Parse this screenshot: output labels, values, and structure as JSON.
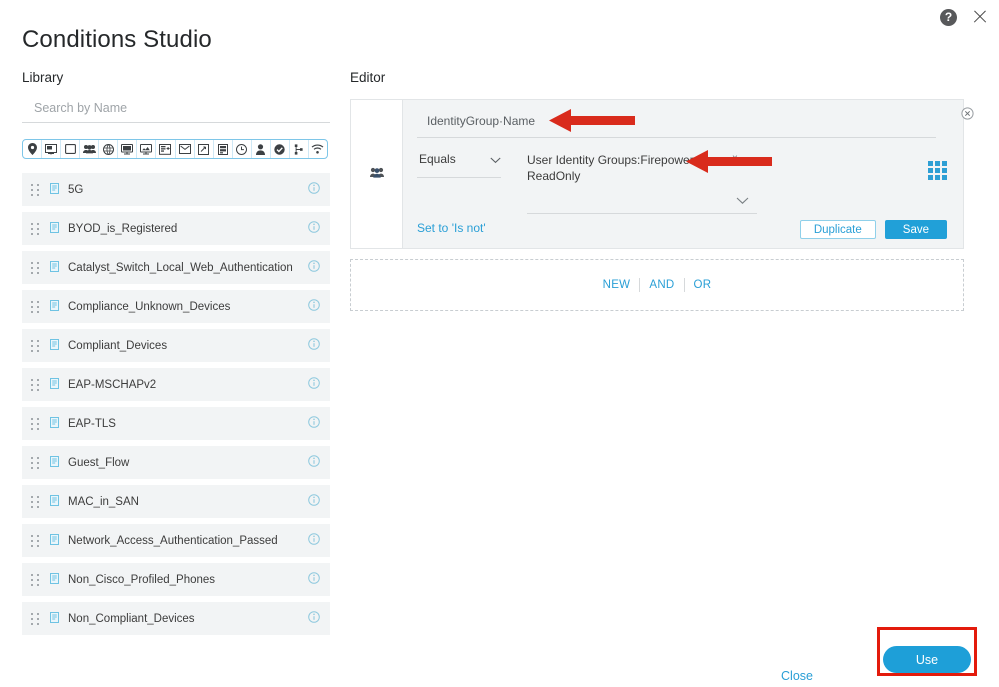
{
  "window": {
    "title": "Conditions Studio",
    "help_icon": "help-circle-icon",
    "close_icon": "close-icon"
  },
  "library": {
    "label": "Library",
    "search": {
      "placeholder": "Search by Name",
      "value": ""
    },
    "filter_icons": [
      "location-pin-icon",
      "network-device-icon",
      "square-outline-icon",
      "identity-group-icon",
      "globe-icon",
      "desktop-icon",
      "monitor-icon",
      "portal-icon",
      "envelope-icon",
      "posture-icon",
      "server-icon",
      "clock-icon",
      "person-icon",
      "check-circle-icon",
      "topology-icon",
      "wifi-icon"
    ],
    "items": [
      {
        "name": "5G",
        "icon": "condition-doc-icon",
        "info": "info-icon"
      },
      {
        "name": "BYOD_is_Registered",
        "icon": "condition-doc-icon",
        "info": "info-icon"
      },
      {
        "name": "Catalyst_Switch_Local_Web_Authentication",
        "icon": "condition-doc-icon",
        "info": "info-icon"
      },
      {
        "name": "Compliance_Unknown_Devices",
        "icon": "condition-doc-icon",
        "info": "info-icon"
      },
      {
        "name": "Compliant_Devices",
        "icon": "condition-doc-icon",
        "info": "info-icon"
      },
      {
        "name": "EAP-MSCHAPv2",
        "icon": "condition-doc-icon",
        "info": "info-icon"
      },
      {
        "name": "EAP-TLS",
        "icon": "condition-doc-icon",
        "info": "info-icon"
      },
      {
        "name": "Guest_Flow",
        "icon": "condition-doc-icon",
        "info": "info-icon"
      },
      {
        "name": "MAC_in_SAN",
        "icon": "condition-doc-icon",
        "info": "info-icon"
      },
      {
        "name": "Network_Access_Authentication_Passed",
        "icon": "condition-doc-icon",
        "info": "info-icon"
      },
      {
        "name": "Non_Cisco_Profiled_Phones",
        "icon": "condition-doc-icon",
        "info": "info-icon"
      },
      {
        "name": "Non_Compliant_Devices",
        "icon": "condition-doc-icon",
        "info": "info-icon"
      }
    ]
  },
  "editor": {
    "label": "Editor",
    "condition": {
      "gutter_icon": "identity-group-icon",
      "attribute": "IdentityGroup·Name",
      "operator": "Equals",
      "value": "User Identity Groups:Firepower ReadOnly",
      "value_remove": "×",
      "set_is_not_label": "Set to 'Is not'",
      "duplicate_label": "Duplicate",
      "save_label": "Save",
      "grid_icon": "grid-picker-icon",
      "close_icon": "remove-condition-icon"
    },
    "logic": {
      "new_label": "NEW",
      "and_label": "AND",
      "or_label": "OR"
    }
  },
  "footer": {
    "close_label": "Close",
    "use_label": "Use"
  },
  "annotations": {
    "arrow_attribute": "red-arrow-pointing-to-attribute",
    "arrow_value": "red-arrow-pointing-to-value",
    "highlight_use": "red-highlight-around-use-button"
  },
  "colors": {
    "accent_blue": "#21a0d8",
    "link_blue": "#2a9fd6",
    "annotation_red": "#e31b0c",
    "row_bg": "#f2f4f5",
    "card_bg": "#f2f4f5"
  }
}
